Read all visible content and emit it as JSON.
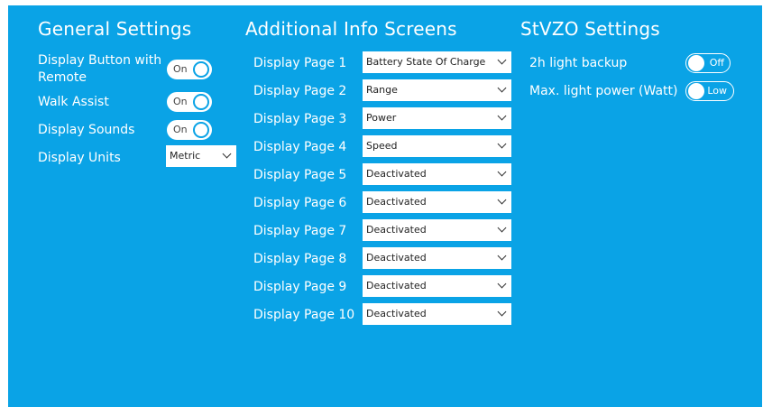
{
  "colors": {
    "background": "#0aa3e6",
    "text": "#ffffff",
    "control_bg": "#ffffff"
  },
  "general": {
    "title": "General Settings",
    "display_button_label": "Display Button with Remote",
    "display_button_toggle": "On",
    "walk_assist_label": "Walk Assist",
    "walk_assist_toggle": "On",
    "display_sounds_label": "Display Sounds",
    "display_sounds_toggle": "On",
    "display_units_label": "Display Units",
    "display_units_value": "Metric"
  },
  "info_screens": {
    "title": "Additional Info Screens",
    "pages": [
      {
        "label": "Display Page 1",
        "value": "Battery State Of Charge"
      },
      {
        "label": "Display Page 2",
        "value": "Range"
      },
      {
        "label": "Display Page 3",
        "value": "Power"
      },
      {
        "label": "Display Page 4",
        "value": "Speed"
      },
      {
        "label": "Display Page 5",
        "value": "Deactivated"
      },
      {
        "label": "Display Page 6",
        "value": "Deactivated"
      },
      {
        "label": "Display Page 7",
        "value": "Deactivated"
      },
      {
        "label": "Display Page 8",
        "value": "Deactivated"
      },
      {
        "label": "Display Page 9",
        "value": "Deactivated"
      },
      {
        "label": "Display Page 10",
        "value": "Deactivated"
      }
    ]
  },
  "stvzo": {
    "title": "StVZO Settings",
    "light_backup_label": "2h light backup",
    "light_backup_toggle": "Off",
    "max_light_label": "Max. light power (Watt)",
    "max_light_toggle": "Low"
  }
}
